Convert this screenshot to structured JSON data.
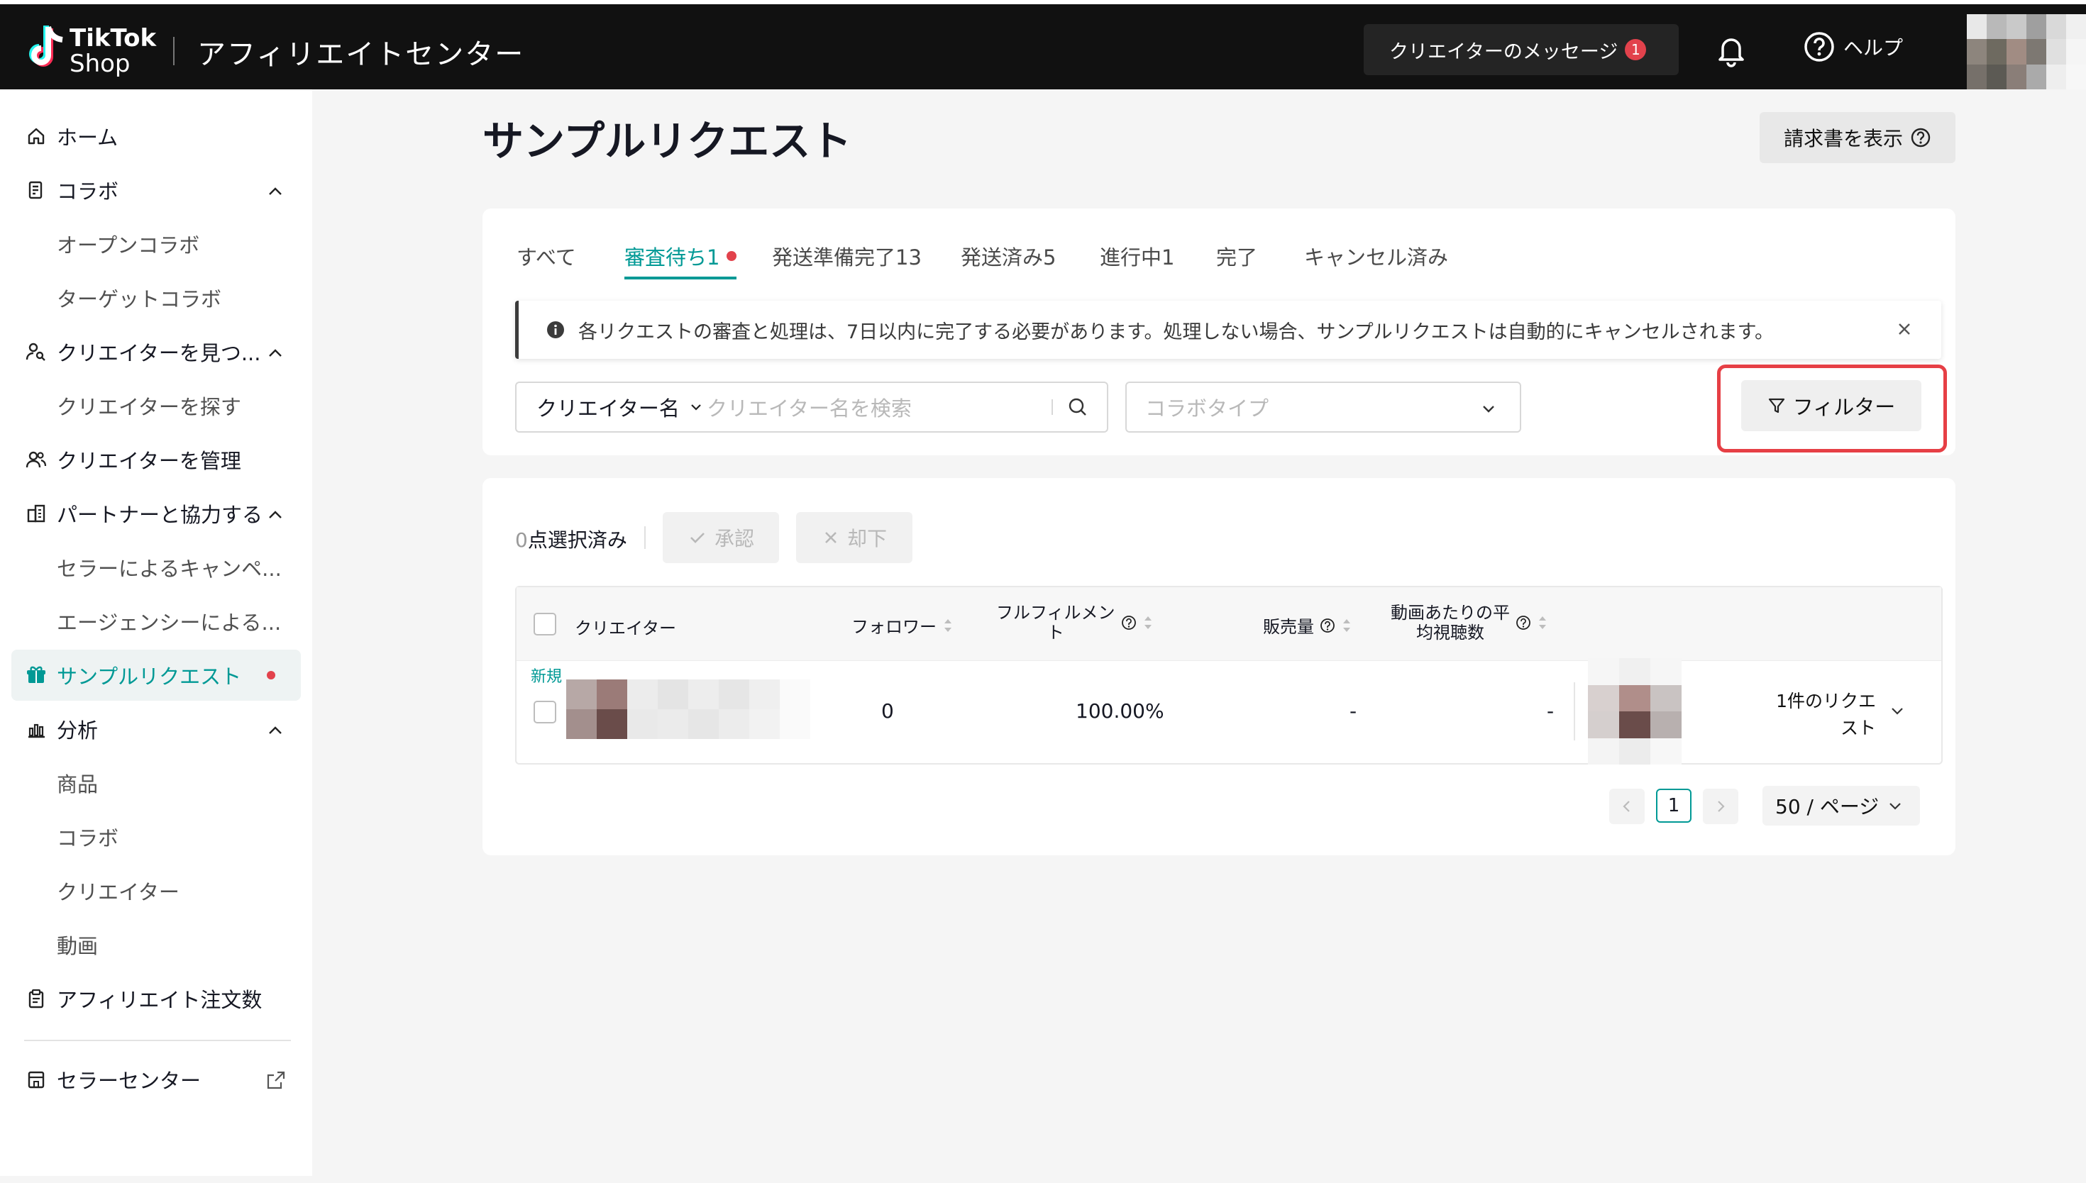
{
  "header": {
    "logo_line1": "TikTok",
    "logo_line2": "Shop",
    "title": "アフィリエイトセンター",
    "messages_label": "クリエイターのメッセージ",
    "messages_count": "1",
    "help_label": "ヘルプ"
  },
  "sidebar": {
    "items": [
      {
        "label": "ホーム",
        "icon": "home-icon"
      },
      {
        "label": "コラボ",
        "icon": "collab-icon"
      },
      {
        "label": "オープンコラボ"
      },
      {
        "label": "ターゲットコラボ"
      },
      {
        "label": "クリエイターを見つ...",
        "icon": "find-creator-icon"
      },
      {
        "label": "クリエイターを探す"
      },
      {
        "label": "クリエイターを管理",
        "icon": "manage-creator-icon"
      },
      {
        "label": "パートナーと協力する",
        "icon": "partner-icon"
      },
      {
        "label": "セラーによるキャンペ..."
      },
      {
        "label": "エージェンシーによる..."
      },
      {
        "label": "サンプルリクエスト",
        "icon": "gift-icon"
      },
      {
        "label": "分析",
        "icon": "analytics-icon"
      },
      {
        "label": "商品"
      },
      {
        "label": "コラボ"
      },
      {
        "label": "クリエイター"
      },
      {
        "label": "動画"
      },
      {
        "label": "アフィリエイト注文数",
        "icon": "clipboard-icon"
      },
      {
        "label": "セラーセンター",
        "icon": "store-icon"
      }
    ]
  },
  "page": {
    "title": "サンプルリクエスト",
    "invoice_button": "請求書を表示"
  },
  "tabs": [
    {
      "label": "すべて"
    },
    {
      "label": "審査待ち1"
    },
    {
      "label": "発送準備完了13"
    },
    {
      "label": "発送済み5"
    },
    {
      "label": "進行中1"
    },
    {
      "label": "完了"
    },
    {
      "label": "キャンセル済み"
    }
  ],
  "notice": {
    "text": "各リクエストの審査と処理は、7日以内に完了する必要があります。処理しない場合、サンプルリクエストは自動的にキャンセルされます。"
  },
  "filters": {
    "search_scope": "クリエイター名",
    "search_placeholder": "クリエイター名を検索",
    "collab_type_placeholder": "コラボタイプ",
    "filter_button": "フィルター"
  },
  "selection": {
    "count": "0",
    "suffix": "点選択済み",
    "approve": "承認",
    "reject": "却下"
  },
  "table": {
    "headers": {
      "creator": "クリエイター",
      "followers": "フォロワー",
      "fulfillment_line1": "フルフィルメン",
      "fulfillment_line2": "ト",
      "sales": "販売量",
      "avg_views_line1": "動画あたりの平",
      "avg_views_line2": "均視聴数"
    },
    "rows": [
      {
        "badge": "新規",
        "followers": "0",
        "fulfillment": "100.00%",
        "sales": "-",
        "avg_views": "-",
        "requests_line1": "1件のリクエ",
        "requests_line2": "スト"
      }
    ]
  },
  "pagination": {
    "current_page": "1",
    "page_size": "50 / ページ"
  },
  "colors": {
    "accent": "#009995",
    "badge_red": "#e2424c",
    "highlight_red": "#e63f45",
    "topbar": "#111111"
  }
}
